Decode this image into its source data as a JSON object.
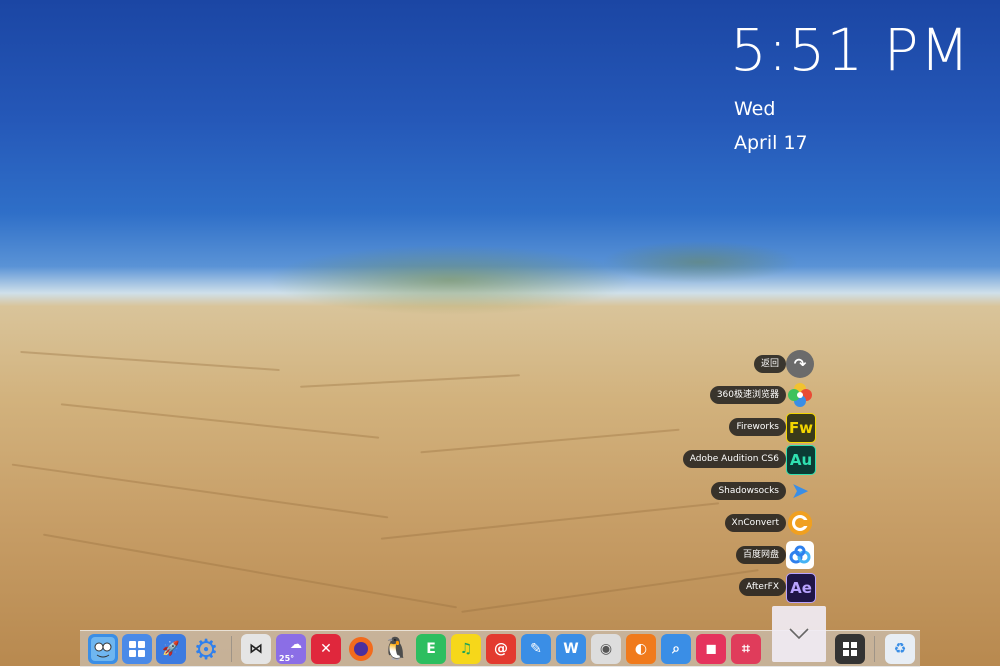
{
  "clock": {
    "time": "5:51 PM",
    "day": "Wed",
    "date": "April 17"
  },
  "stack": {
    "items": [
      {
        "label": "返回",
        "icon": "back-arrow-icon",
        "color": "#6b6b6b",
        "glyph": "↷"
      },
      {
        "label": "360极速浏览器",
        "icon": "360-browser-icon",
        "color": "#ffffff",
        "glyph": ""
      },
      {
        "label": "Fireworks",
        "icon": "fireworks-icon",
        "color": "#f3d500",
        "glyph": "Fw"
      },
      {
        "label": "Adobe Audition CS6",
        "icon": "audition-icon",
        "color": "#0e5e52",
        "glyph": "Au"
      },
      {
        "label": "Shadowsocks",
        "icon": "shadowsocks-icon",
        "color": "transparent",
        "glyph": "➤"
      },
      {
        "label": "XnConvert",
        "icon": "xnconvert-icon",
        "color": "transparent",
        "glyph": "C"
      },
      {
        "label": "百度网盘",
        "icon": "baidu-netdisk-icon",
        "color": "#ffffff",
        "glyph": "∞"
      },
      {
        "label": "AfterFX",
        "icon": "aftereffects-icon",
        "color": "#1f1546",
        "glyph": "Ae"
      }
    ]
  },
  "dock": {
    "weather_temp": "25°",
    "apps": [
      "finder-icon",
      "launchpad-grid-icon",
      "rocket-icon",
      "settings-gear-icon",
      "bowtie-icon",
      "weather-icon",
      "xmind-icon",
      "firefox-icon",
      "qq-icon",
      "evernote-icon",
      "qq-music-icon",
      "netease-music-icon",
      "note-icon",
      "wps-icon",
      "dvd-icon",
      "ubuntu-icon",
      "search-icon",
      "screenshot-icon",
      "crop-icon",
      "stack-expand-icon",
      "windows-start-icon",
      "recycle-bin-icon"
    ]
  }
}
